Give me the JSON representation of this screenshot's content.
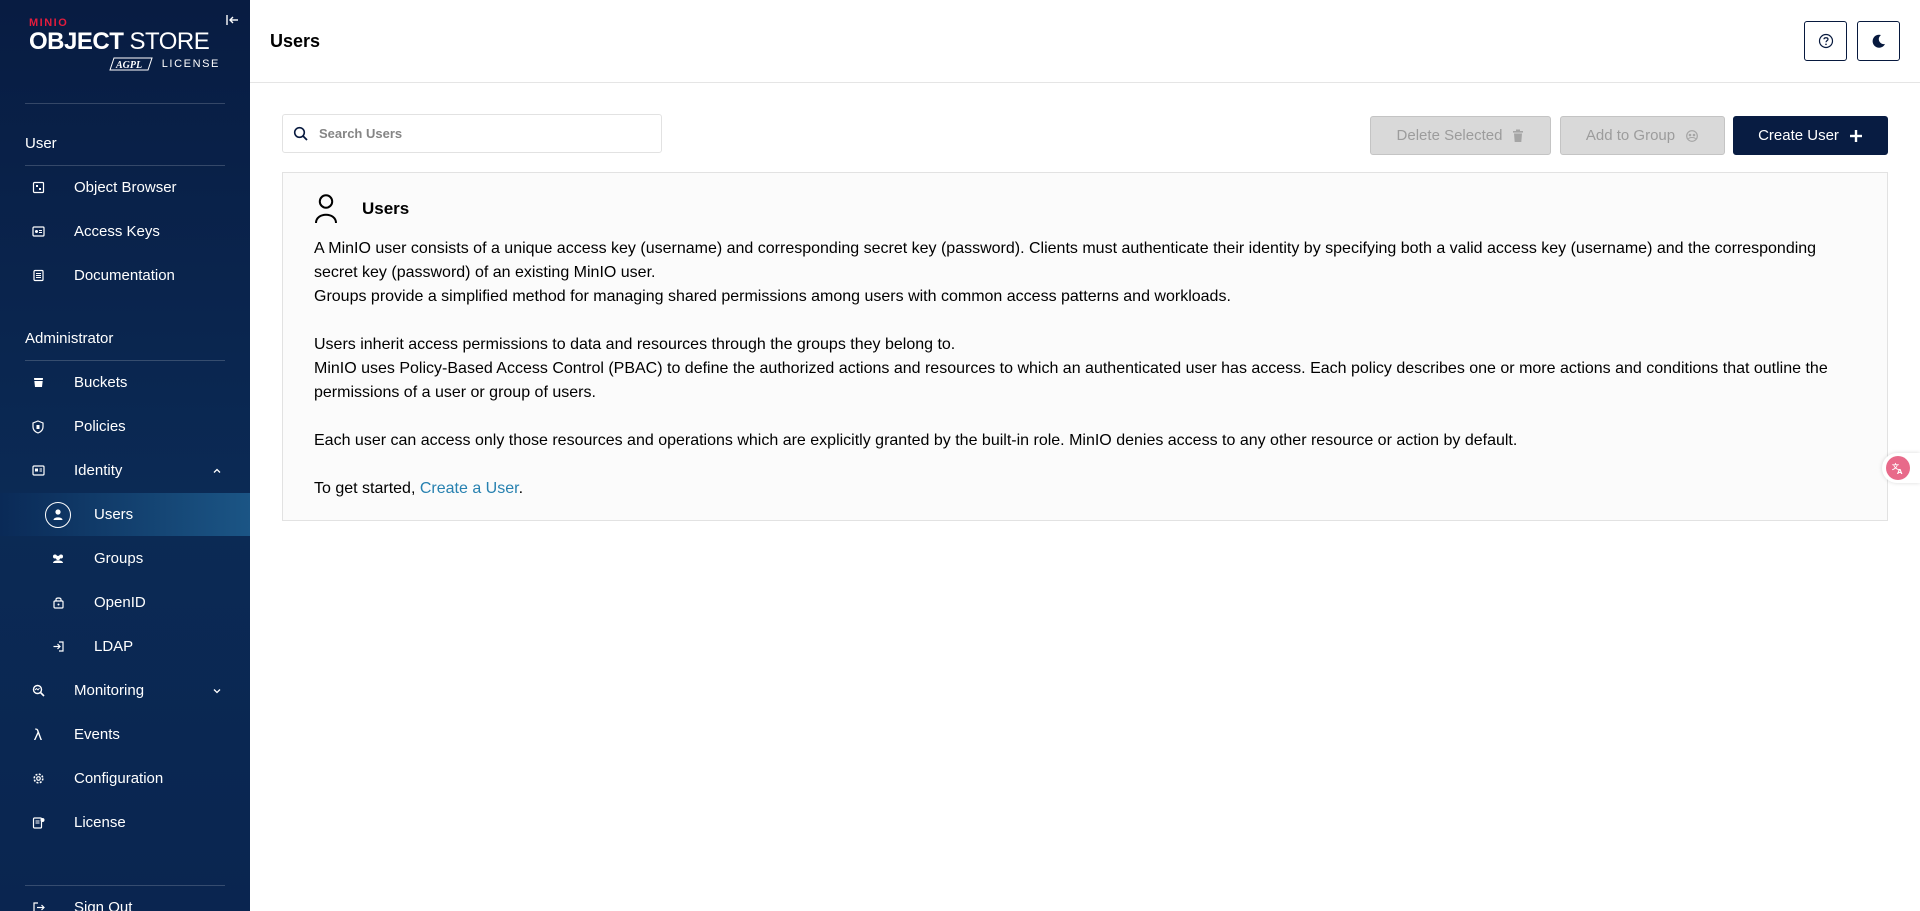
{
  "logo": {
    "brand": "MINIO",
    "product_bold": "OBJECT",
    "product_light": " STORE",
    "license_badge": "AGPL",
    "license_label": "LICENSE"
  },
  "sidebar": {
    "user_section": "User",
    "user_items": [
      {
        "label": "Object Browser",
        "icon": "object-browser-icon"
      },
      {
        "label": "Access Keys",
        "icon": "access-keys-icon"
      },
      {
        "label": "Documentation",
        "icon": "documentation-icon"
      }
    ],
    "admin_section": "Administrator",
    "admin_items": [
      {
        "label": "Buckets",
        "icon": "bucket-icon"
      },
      {
        "label": "Policies",
        "icon": "policy-icon"
      },
      {
        "label": "Identity",
        "icon": "identity-icon",
        "expanded": true
      },
      {
        "label": "Users",
        "icon": "user-icon",
        "active": true
      },
      {
        "label": "Groups",
        "icon": "groups-icon"
      },
      {
        "label": "OpenID",
        "icon": "openid-icon"
      },
      {
        "label": "LDAP",
        "icon": "ldap-icon"
      },
      {
        "label": "Monitoring",
        "icon": "monitoring-icon",
        "expanded": false
      },
      {
        "label": "Events",
        "icon": "lambda-icon"
      },
      {
        "label": "Configuration",
        "icon": "gear-icon"
      },
      {
        "label": "License",
        "icon": "license-icon"
      }
    ],
    "sign_out": "Sign Out"
  },
  "header": {
    "title": "Users"
  },
  "toolbar": {
    "search_placeholder": "Search Users",
    "delete_selected": "Delete Selected",
    "add_to_group": "Add to Group",
    "create_user": "Create User"
  },
  "help": {
    "title": "Users",
    "p1": "A MinIO user consists of a unique access key (username) and corresponding secret key (password). Clients must authenticate their identity by specifying both a valid access key (username) and the corresponding secret key (password) of an existing MinIO user.",
    "p2": "Groups provide a simplified method for managing shared permissions among users with common access patterns and workloads.",
    "p3": "Users inherit access permissions to data and resources through the groups they belong to.",
    "p4": "MinIO uses Policy-Based Access Control (PBAC) to define the authorized actions and resources to which an authenticated user has access. Each policy describes one or more actions and conditions that outline the permissions of a user or group of users.",
    "p5": "Each user can access only those resources and operations which are explicitly granted by the built-in role. MinIO denies access to any other resource or action by default.",
    "get_started_prefix": "To get started, ",
    "create_link": "Create a User",
    "get_started_suffix": "."
  },
  "colors": {
    "sidebar_bg": "#081c42",
    "primary": "#081c42",
    "link": "#2781b0",
    "brand_red": "#e31c3d"
  }
}
